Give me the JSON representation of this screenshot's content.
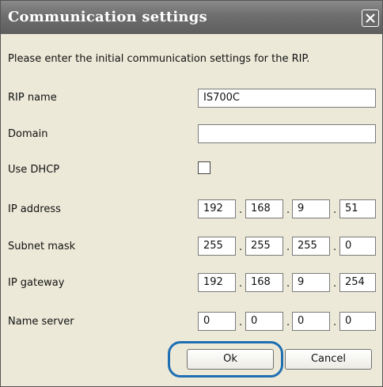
{
  "dialog": {
    "title": "Communication settings",
    "close_icon": "close-icon",
    "intro": "Please enter the initial communication settings for the RIP."
  },
  "fields": {
    "rip_name": {
      "label": "RIP name",
      "value": "IS700C"
    },
    "domain": {
      "label": "Domain",
      "value": ""
    },
    "use_dhcp": {
      "label": "Use DHCP",
      "checked": false
    },
    "ip_address": {
      "label": "IP address",
      "octets": [
        "192",
        "168",
        "9",
        "51"
      ]
    },
    "subnet_mask": {
      "label": "Subnet mask",
      "octets": [
        "255",
        "255",
        "255",
        "0"
      ]
    },
    "ip_gateway": {
      "label": "IP gateway",
      "octets": [
        "192",
        "168",
        "9",
        "254"
      ]
    },
    "name_server": {
      "label": "Name server",
      "octets": [
        "0",
        "0",
        "0",
        "0"
      ]
    }
  },
  "separator": ".",
  "buttons": {
    "ok": "Ok",
    "cancel": "Cancel"
  },
  "colors": {
    "highlight": "#1f6fb2",
    "titlebar": "#6e6e6e"
  }
}
